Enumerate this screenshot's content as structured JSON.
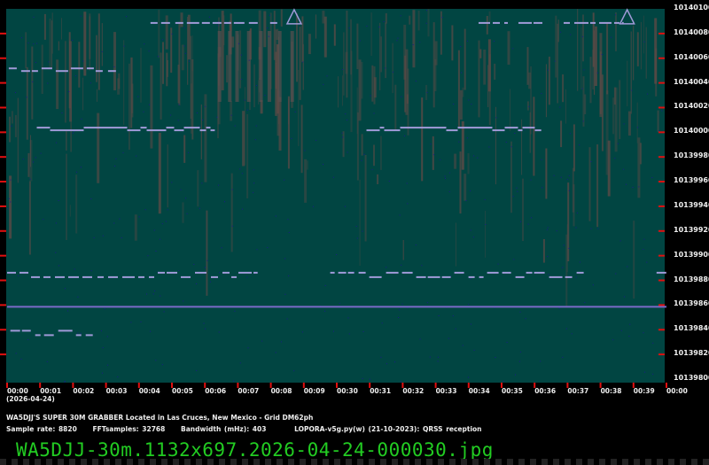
{
  "chart_data": {
    "type": "heatmap",
    "description_kind": "QRSS waterfall spectrogram",
    "colors": {
      "background": "#014542",
      "signal": "#a09ad8",
      "noise": "#5e4a46",
      "tick": "#e01010",
      "filename": "#22cc22"
    },
    "y_ticks": [
      "10140100",
      "10140080",
      "10140060",
      "10140040",
      "10140020",
      "10140000",
      "10139980",
      "10139960",
      "10139940",
      "10139920",
      "10139900",
      "10139880",
      "10139860",
      "10139840",
      "10139820",
      "10139800"
    ],
    "ylim": [
      10139800,
      10140100
    ],
    "x_ticks": [
      "00:00",
      "00:01",
      "00:02",
      "00:03",
      "00:04",
      "00:05",
      "00:06",
      "00:07",
      "00:08",
      "00:09",
      "00:30",
      "00:31",
      "00:32",
      "00:33",
      "00:34",
      "00:35",
      "00:36",
      "00:37",
      "00:38",
      "00:39",
      "00:00"
    ],
    "traces": [
      {
        "freq": 10140085,
        "start": 4.35,
        "end": 8.6,
        "style": "morse"
      },
      {
        "freq": 10140085,
        "start": 14.3,
        "end": 18.7,
        "style": "morse"
      },
      {
        "freq": 10140046,
        "start": 0.05,
        "end": 3.3,
        "style": "fsk"
      },
      {
        "freq": 10139998,
        "start": 0.9,
        "end": 6.3,
        "style": "step"
      },
      {
        "freq": 10139998,
        "start": 10.9,
        "end": 16.2,
        "style": "step"
      },
      {
        "freq": 10139879,
        "start": 0.0,
        "end": 7.6,
        "style": "dual"
      },
      {
        "freq": 10139879,
        "start": 9.8,
        "end": 17.5,
        "style": "dual"
      },
      {
        "freq": 10139879,
        "start": 19.7,
        "end": 20.0,
        "style": "dual"
      },
      {
        "freq": 10139855,
        "start": 0.0,
        "end": 20.0,
        "style": "carrier"
      },
      {
        "freq": 10139832,
        "start": 0.1,
        "end": 2.6,
        "style": "dual"
      }
    ]
  },
  "footer": {
    "date": "(2026-04-24)",
    "title": "WA5DJJ'S SUPER 30M GRABBER Located in Las Cruces, New Mexico - Grid DM62ph",
    "sample_rate": "Sample rate: 8820",
    "fft_samples": "FFTsamples: 32768",
    "bandwidth": "Bandwidth (mHz): 403",
    "software": "LOPORA-v5g.py(w) (21-10-2023): QRSS reception",
    "filename": "WA5DJJ-30m.1132x697.2026-04-24-000030.jpg"
  }
}
